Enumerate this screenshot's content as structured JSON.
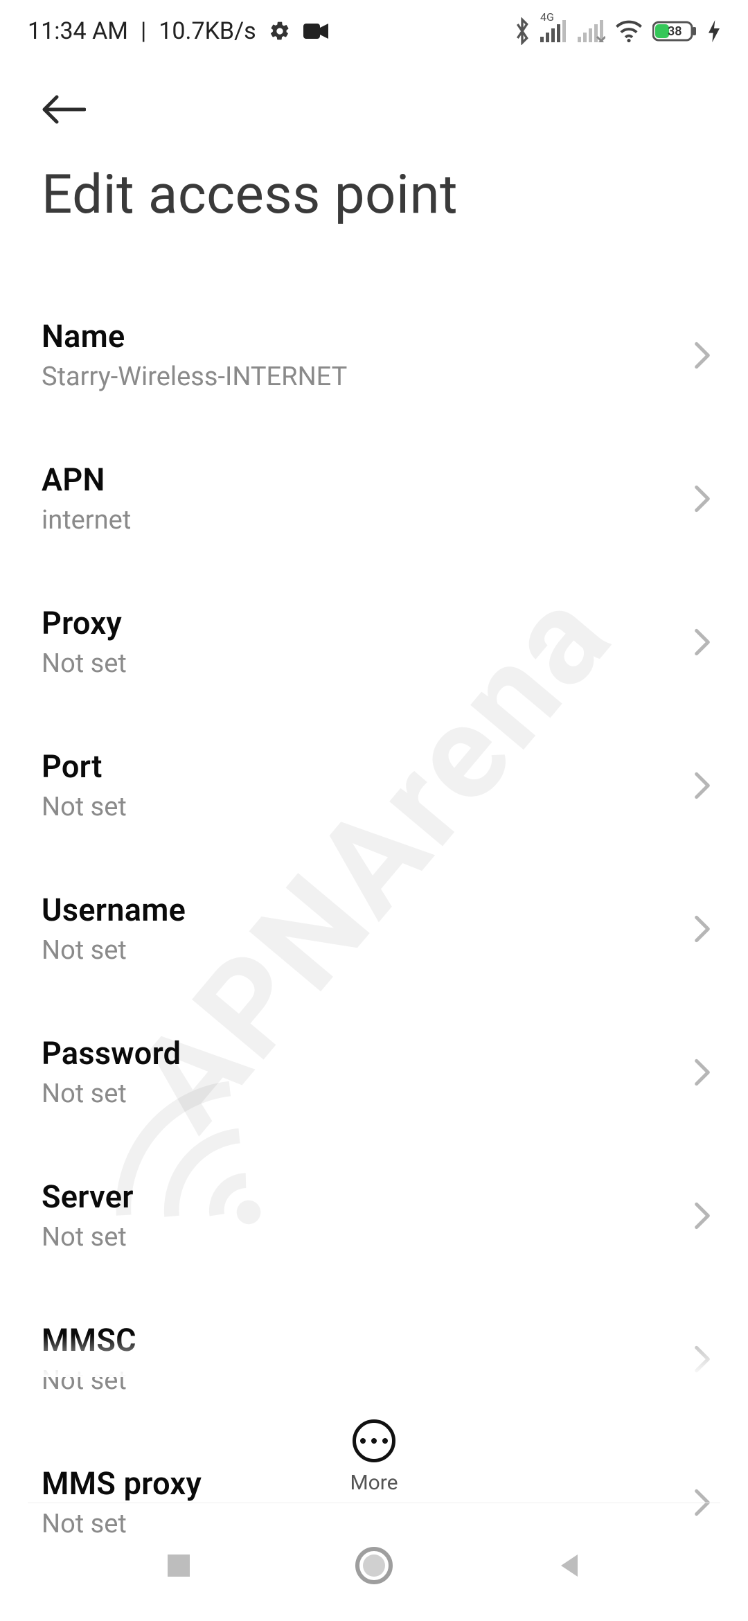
{
  "statusbar": {
    "time": "11:34 AM",
    "net_speed": "10.7KB/s",
    "network_label": "4G",
    "battery_pct": "38"
  },
  "header": {
    "title": "Edit access point"
  },
  "rows": [
    {
      "label": "Name",
      "value": "Starry-Wireless-INTERNET"
    },
    {
      "label": "APN",
      "value": "internet"
    },
    {
      "label": "Proxy",
      "value": "Not set"
    },
    {
      "label": "Port",
      "value": "Not set"
    },
    {
      "label": "Username",
      "value": "Not set"
    },
    {
      "label": "Password",
      "value": "Not set"
    },
    {
      "label": "Server",
      "value": "Not set"
    },
    {
      "label": "MMSC",
      "value": "Not set"
    },
    {
      "label": "MMS proxy",
      "value": "Not set"
    }
  ],
  "more": {
    "label": "More"
  },
  "watermark": "APNArena"
}
